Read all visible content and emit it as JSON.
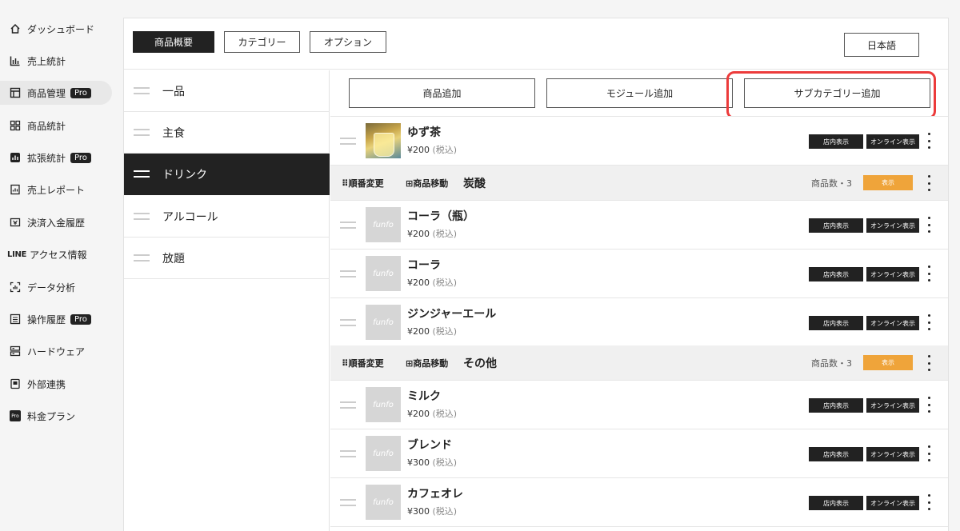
{
  "sidebar": {
    "items": [
      {
        "label": "ダッシュボード",
        "icon": "home-icon",
        "pro": false
      },
      {
        "label": "売上統計",
        "icon": "bar-chart-icon",
        "pro": false
      },
      {
        "label": "商品管理",
        "icon": "layout-icon",
        "pro": true,
        "active": true
      },
      {
        "label": "商品統計",
        "icon": "grid-icon",
        "pro": false
      },
      {
        "label": "拡張統計",
        "icon": "chart-box-icon",
        "pro": true
      },
      {
        "label": "売上レポート",
        "icon": "report-icon",
        "pro": false
      },
      {
        "label": "決済入金履歴",
        "icon": "payment-icon",
        "pro": false
      },
      {
        "label": "アクセス情報",
        "icon": "line-logo",
        "logo_text": "LINE",
        "pro": false
      },
      {
        "label": "データ分析",
        "icon": "analysis-icon",
        "pro": false
      },
      {
        "label": "操作履歴",
        "icon": "list-icon",
        "pro": true
      },
      {
        "label": "ハードウェア",
        "icon": "hardware-icon",
        "pro": false
      },
      {
        "label": "外部連携",
        "icon": "link-doc-icon",
        "pro": false
      },
      {
        "label": "料金プラン",
        "icon": "pro-plan-icon",
        "pro": false
      }
    ],
    "pro_label": "Pro",
    "pro_icon_text": "Pro"
  },
  "topbar": {
    "tabs": [
      "商品概要",
      "カテゴリー",
      "オプション"
    ],
    "active_tab": 0,
    "language": "日本語"
  },
  "categories": [
    {
      "label": "一品"
    },
    {
      "label": "主食"
    },
    {
      "label": "ドリンク",
      "active": true
    },
    {
      "label": "アルコール"
    },
    {
      "label": "放題"
    }
  ],
  "actions": {
    "add_product": "商品追加",
    "add_module": "モジュール追加",
    "add_subcategory": "サブカテゴリー追加"
  },
  "labels": {
    "tax": "(税込)",
    "store_display": "店内表示",
    "online_display": "オンライン表示",
    "reorder": "順番変更",
    "move_products": "商品移動",
    "count_prefix": "商品数・",
    "show": "表示",
    "placeholder_logo": "funfo"
  },
  "products_top": [
    {
      "name": "ゆず茶",
      "price": "¥200",
      "photo": true
    }
  ],
  "subcategories": [
    {
      "name": "炭酸",
      "count": "3",
      "products": [
        {
          "name": "コーラ（瓶）",
          "price": "¥200"
        },
        {
          "name": "コーラ",
          "price": "¥200"
        },
        {
          "name": "ジンジャーエール",
          "price": "¥200"
        }
      ]
    },
    {
      "name": "その他",
      "count": "3",
      "products": [
        {
          "name": "ミルク",
          "price": "¥200"
        },
        {
          "name": "ブレンド",
          "price": "¥300"
        },
        {
          "name": "カフェオレ",
          "price": "¥300"
        }
      ]
    }
  ],
  "colors": {
    "accent_orange": "#efa43a",
    "highlight_red": "#ec3b3b",
    "dark": "#222222"
  }
}
